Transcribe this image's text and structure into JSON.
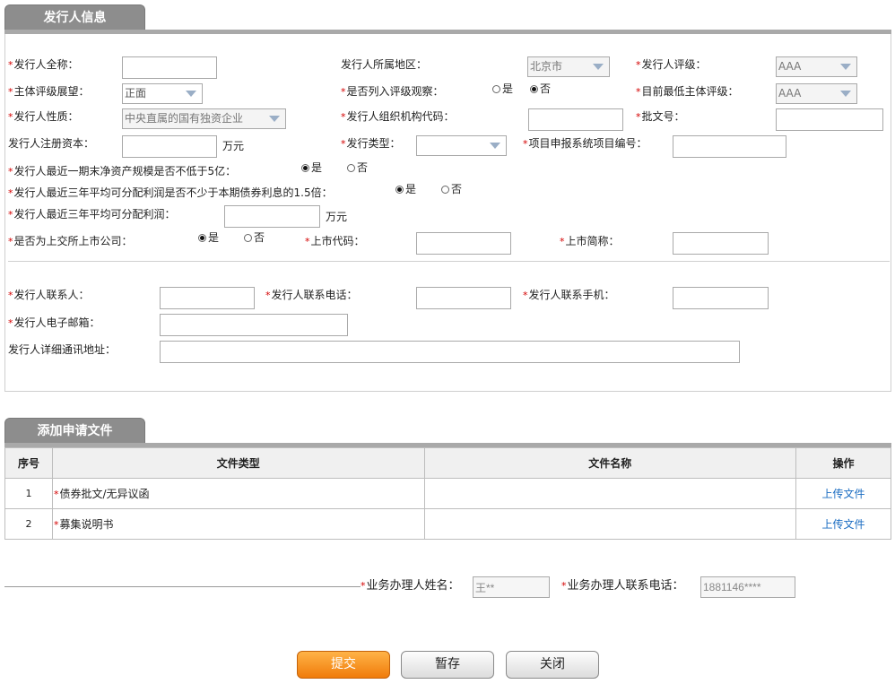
{
  "issuer_section": {
    "tab_label": "发行人信息",
    "full_name": {
      "label": "发行人全称：",
      "value": ""
    },
    "region": {
      "label": "发行人所属地区：",
      "value": "北京市"
    },
    "rating": {
      "label": "发行人评级：",
      "value": "AAA"
    },
    "outlook": {
      "label": "主体评级展望：",
      "value": "正面"
    },
    "watchlist": {
      "label": "是否列入评级观察：",
      "yes": "是",
      "no": "否",
      "selected": "no"
    },
    "min_rating": {
      "label": "目前最低主体评级：",
      "value": "AAA"
    },
    "nature": {
      "label": "发行人性质：",
      "value": "中央直属的国有独资企业"
    },
    "org_code": {
      "label": "发行人组织机构代码：",
      "value": ""
    },
    "approval_no": {
      "label": "批文号：",
      "value": ""
    },
    "reg_capital": {
      "label": "发行人注册资本：",
      "value": "",
      "unit": "万元"
    },
    "issue_type": {
      "label": "发行类型：",
      "value": ""
    },
    "project_no": {
      "label": "项目申报系统项目编号：",
      "value": ""
    },
    "net_assets_q": {
      "label": "发行人最近一期末净资产规模是否不低于5亿：",
      "yes": "是",
      "no": "否",
      "selected": "yes"
    },
    "profit_q": {
      "label": "发行人最近三年平均可分配利润是否不少于本期债券利息的1.5倍：",
      "yes": "是",
      "no": "否",
      "selected": "yes"
    },
    "avg_profit": {
      "label": "发行人最近三年平均可分配利润：",
      "value": "",
      "unit": "万元"
    },
    "listed_q": {
      "label": "是否为上交所上市公司：",
      "yes": "是",
      "no": "否",
      "selected": "yes"
    },
    "listing_code": {
      "label": "上市代码：",
      "value": ""
    },
    "listing_abbr": {
      "label": "上市简称：",
      "value": ""
    },
    "contact": {
      "label": "发行人联系人：",
      "value": ""
    },
    "phone": {
      "label": "发行人联系电话：",
      "value": ""
    },
    "mobile": {
      "label": "发行人联系手机：",
      "value": ""
    },
    "email": {
      "label": "发行人电子邮箱：",
      "value": ""
    },
    "address": {
      "label": "发行人详细通讯地址：",
      "value": ""
    }
  },
  "files_section": {
    "tab_label": "添加申请文件",
    "columns": [
      "序号",
      "文件类型",
      "文件名称",
      "操作"
    ],
    "rows": [
      {
        "no": "1",
        "type": "债券批文/无异议函",
        "name": "",
        "action": "上传文件"
      },
      {
        "no": "2",
        "type": "募集说明书",
        "name": "",
        "action": "上传文件"
      }
    ]
  },
  "agent": {
    "name_label": "业务办理人姓名：",
    "name_value": "王**",
    "phone_label": "业务办理人联系电话：",
    "phone_value": "1881146****"
  },
  "buttons": {
    "submit": "提交",
    "save": "暂存",
    "close": "关闭"
  },
  "colors": {
    "required": "#d40000",
    "tab": "#8d8d8d",
    "submit": "#f07b0a",
    "link": "#1a6cc2"
  }
}
